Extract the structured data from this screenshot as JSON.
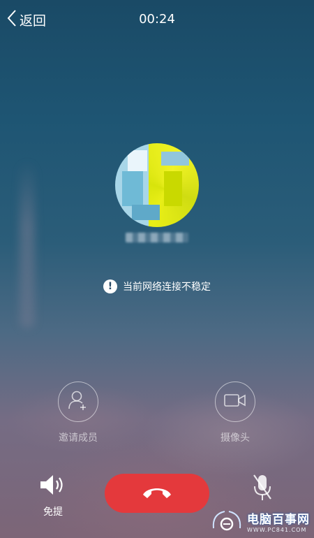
{
  "header": {
    "back_label": "返回",
    "timer": "00:24"
  },
  "status": {
    "warning_text": "当前网络连接不稳定"
  },
  "actions": {
    "invite_label": "邀请成员",
    "camera_label": "摄像头"
  },
  "controls": {
    "speaker_label": "免提"
  },
  "watermark": {
    "title": "电脑百事网",
    "url": "WWW.PC841.COM"
  },
  "colors": {
    "hangup": "#e4393c",
    "background_top": "#1a4a66"
  }
}
